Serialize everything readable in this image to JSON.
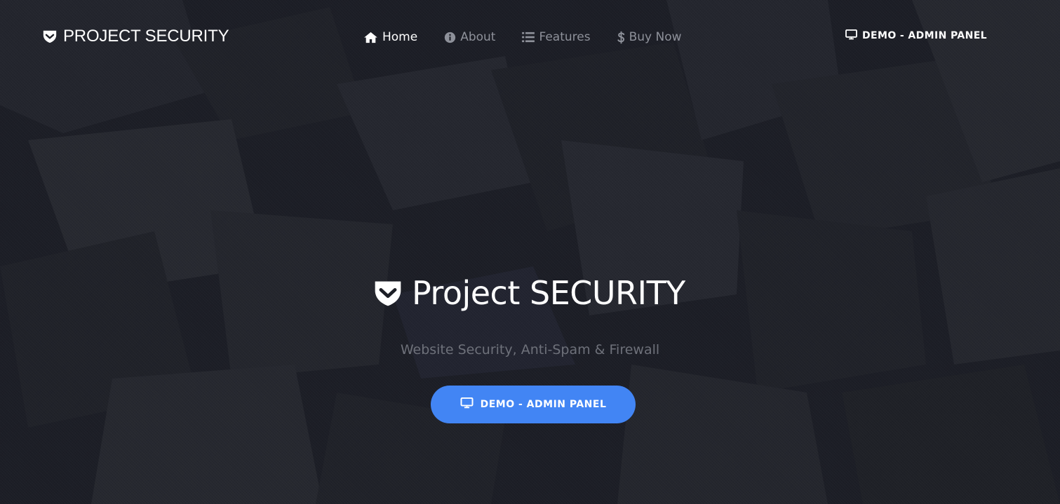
{
  "header": {
    "brand": {
      "icon": "shield-check-icon",
      "text": "PROJECT SECURITY"
    },
    "nav": [
      {
        "icon": "home-icon",
        "label": "Home",
        "active": true
      },
      {
        "icon": "info-circle-icon",
        "label": "About",
        "active": false
      },
      {
        "icon": "list-icon",
        "label": "Features",
        "active": false
      },
      {
        "icon": "dollar-icon",
        "label": "Buy Now",
        "active": false
      }
    ],
    "right_link": {
      "icon": "monitor-icon",
      "label": "DEMO - ADMIN PANEL"
    }
  },
  "hero": {
    "icon": "shield-check-icon",
    "title": "Project SECURITY",
    "subtitle": "Website Security, Anti-Spam & Firewall",
    "button": {
      "icon": "monitor-icon",
      "label": "DEMO - ADMIN PANEL"
    }
  },
  "colors": {
    "background": "#1c1e26",
    "accent": "#4285f4",
    "nav_inactive": "#8e919a",
    "subtitle": "#6e717a",
    "text": "#ffffff"
  }
}
